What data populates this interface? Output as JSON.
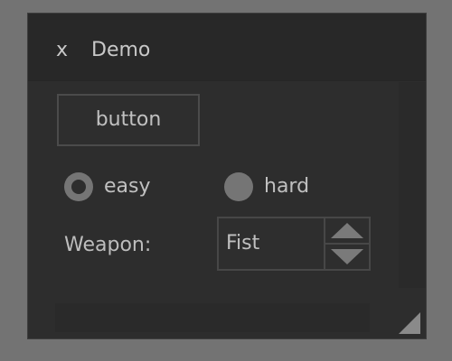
{
  "window": {
    "title": "Demo",
    "close_glyph": "x"
  },
  "controls": {
    "button_label": "button",
    "difficulty_options": [
      "easy",
      "hard"
    ],
    "difficulty_selected": "easy",
    "weapon_label": "Weapon:",
    "weapon_value": "Fist"
  },
  "icons": {
    "spinner_up": "triangle-up-icon",
    "spinner_down": "triangle-down-icon",
    "resize": "resize-grip-icon"
  },
  "colors": {
    "desktop": "#737373",
    "window_bg": "#2d2d2d",
    "text": "#c0c0c0",
    "accent": "#757575"
  }
}
